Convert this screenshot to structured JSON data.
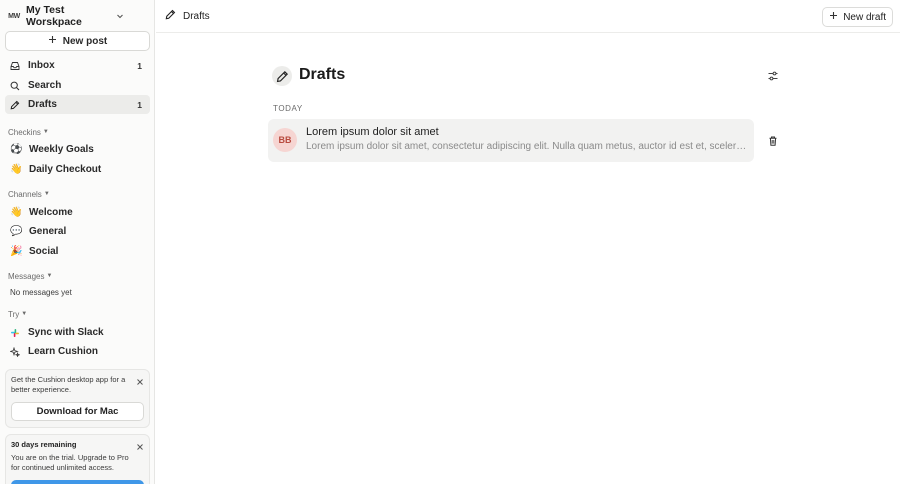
{
  "workspace": {
    "initials": "MW",
    "name": "My Test Worskpace"
  },
  "sidebar": {
    "new_post_label": "New post",
    "nav": [
      {
        "label": "Inbox",
        "count": "1",
        "icon": "inbox-icon"
      },
      {
        "label": "Search",
        "count": "",
        "icon": "search-icon"
      },
      {
        "label": "Drafts",
        "count": "1",
        "icon": "pencil-icon",
        "active": true
      }
    ],
    "checkins": {
      "heading": "Checkins",
      "items": [
        {
          "label": "Weekly Goals",
          "emoji": "⚽"
        },
        {
          "label": "Daily Checkout",
          "emoji": "👋"
        }
      ]
    },
    "channels": {
      "heading": "Channels",
      "items": [
        {
          "label": "Welcome",
          "emoji": "👋"
        },
        {
          "label": "General",
          "emoji": "💬"
        },
        {
          "label": "Social",
          "emoji": "🎉"
        }
      ]
    },
    "messages": {
      "heading": "Messages",
      "empty_text": "No messages yet"
    },
    "try": {
      "heading": "Try",
      "items": [
        {
          "label": "Sync with Slack",
          "icon": "slack-icon"
        },
        {
          "label": "Learn Cushion",
          "icon": "sparkle-icon"
        }
      ]
    },
    "desktop_promo": {
      "text": "Get the Cushion desktop app for a better experience.",
      "button_label": "Download for Mac"
    },
    "trial_promo": {
      "title": "30 days remaining",
      "text": "You are on the trial. Upgrade to Pro for continued unlimited access.",
      "accent_color": "#3f97e8"
    }
  },
  "topbar": {
    "breadcrumb": "Drafts",
    "new_draft_label": "New draft"
  },
  "main": {
    "title": "Drafts",
    "group_label": "TODAY",
    "drafts": [
      {
        "avatar_initials": "BB",
        "title": "Lorem ipsum dolor sit amet",
        "snippet": "Lorem ipsum dolor sit amet, consectetur adipiscing elit. Nulla quam metus, auctor id est et, scelerisque"
      }
    ]
  },
  "colors": {
    "sidebar_bg": "#fbfbfa",
    "active_item_bg": "#ececea",
    "draft_row_bg": "#f2f2f1",
    "avatar_bg": "#f6d5d2",
    "avatar_text": "#b84a3e"
  }
}
